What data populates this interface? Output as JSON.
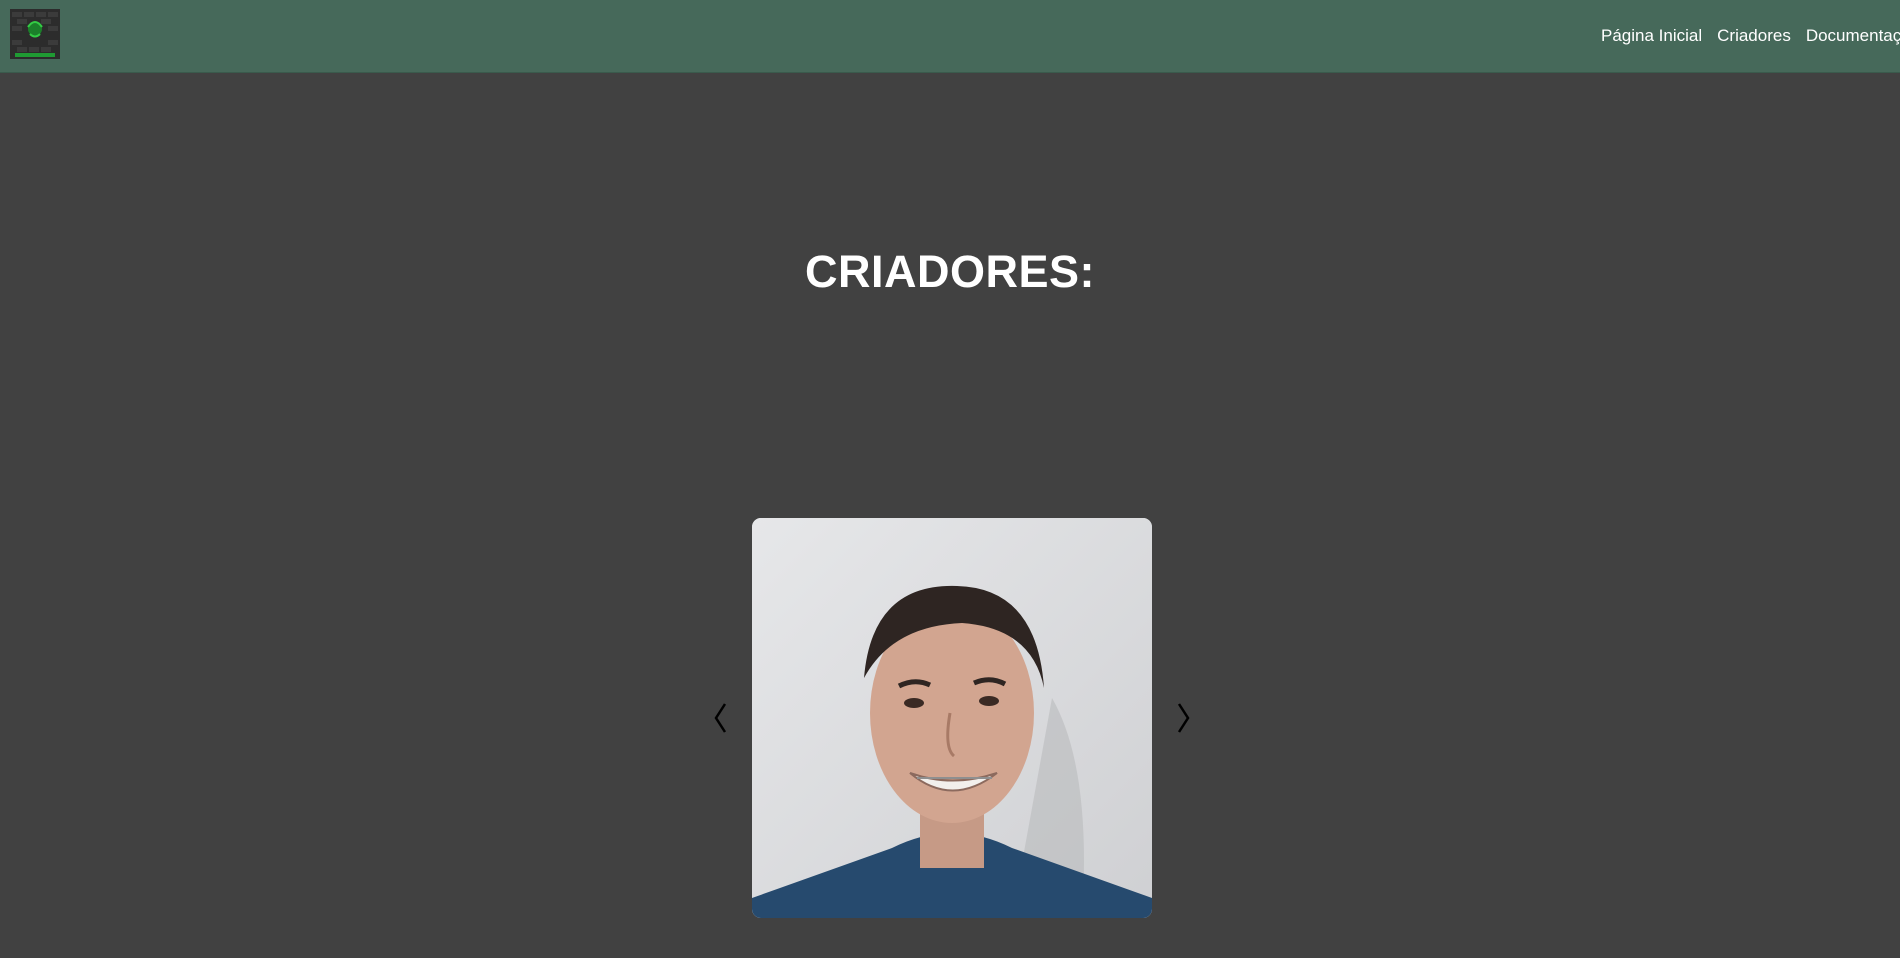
{
  "header": {
    "logo_icon": "shield-logo-icon",
    "nav": [
      {
        "label": "Página Inicial"
      },
      {
        "label": "Criadores"
      },
      {
        "label": "Documentação"
      }
    ]
  },
  "main": {
    "title": "CRIADORES:",
    "carousel": {
      "prev_icon": "chevron-left-icon",
      "next_icon": "chevron-right-icon",
      "photo_icon": "person-photo"
    }
  },
  "colors": {
    "navbar": "#46695a",
    "background": "#414141",
    "text": "#ffffff"
  }
}
